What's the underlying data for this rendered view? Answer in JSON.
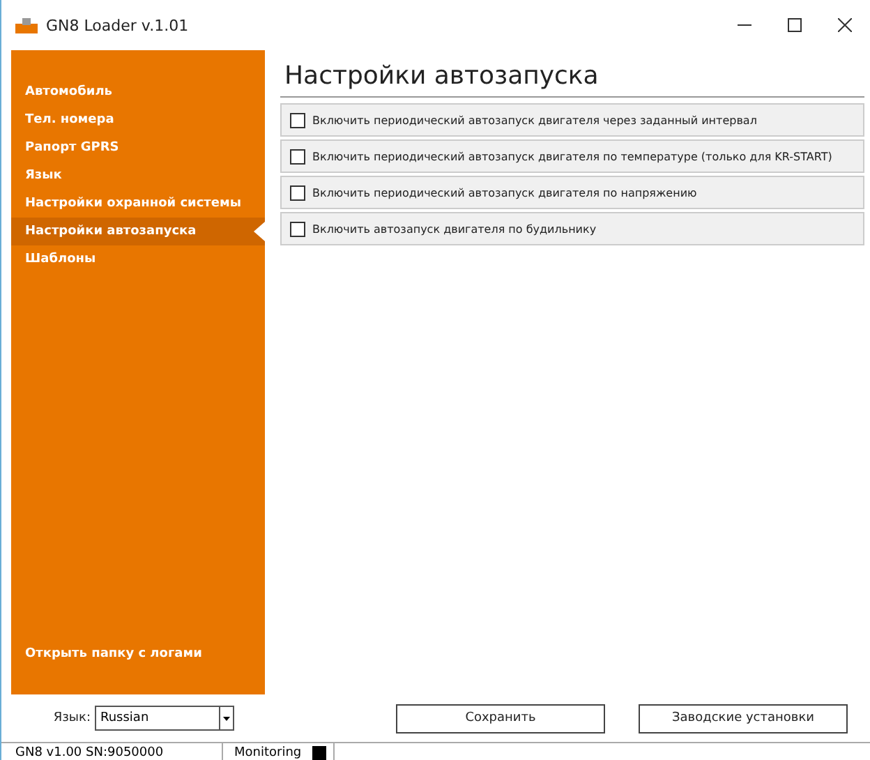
{
  "window": {
    "title": "GN8 Loader v.1.01"
  },
  "sidebar": {
    "items": [
      {
        "label": "Автомобиль",
        "selected": false
      },
      {
        "label": "Тел. номера",
        "selected": false
      },
      {
        "label": "Рапорт GPRS",
        "selected": false
      },
      {
        "label": "Язык",
        "selected": false
      },
      {
        "label": "Настройки охранной системы",
        "selected": false
      },
      {
        "label": "Настройки автозапуска",
        "selected": true
      },
      {
        "label": "Шаблоны",
        "selected": false
      }
    ],
    "logs_link": "Открыть папку с логами"
  },
  "page": {
    "title": "Настройки автозапуска",
    "options": [
      {
        "label": "Включить периодический автозапуск двигателя через заданный интервал",
        "checked": false
      },
      {
        "label": "Включить периодический автозапуск двигателя по температуре (только для KR-START)",
        "checked": false
      },
      {
        "label": "Включить периодический автозапуск двигателя по напряжению",
        "checked": false
      },
      {
        "label": "Включить автозапуск двигателя по будильнику",
        "checked": false
      }
    ]
  },
  "language": {
    "label": "Язык:",
    "value": "Russian"
  },
  "buttons": [
    "Сохранить",
    "Заводские установки"
  ],
  "status_bar": {
    "device": "GN8 v1.00 SN:9050000",
    "monitoring": "Monitoring"
  }
}
